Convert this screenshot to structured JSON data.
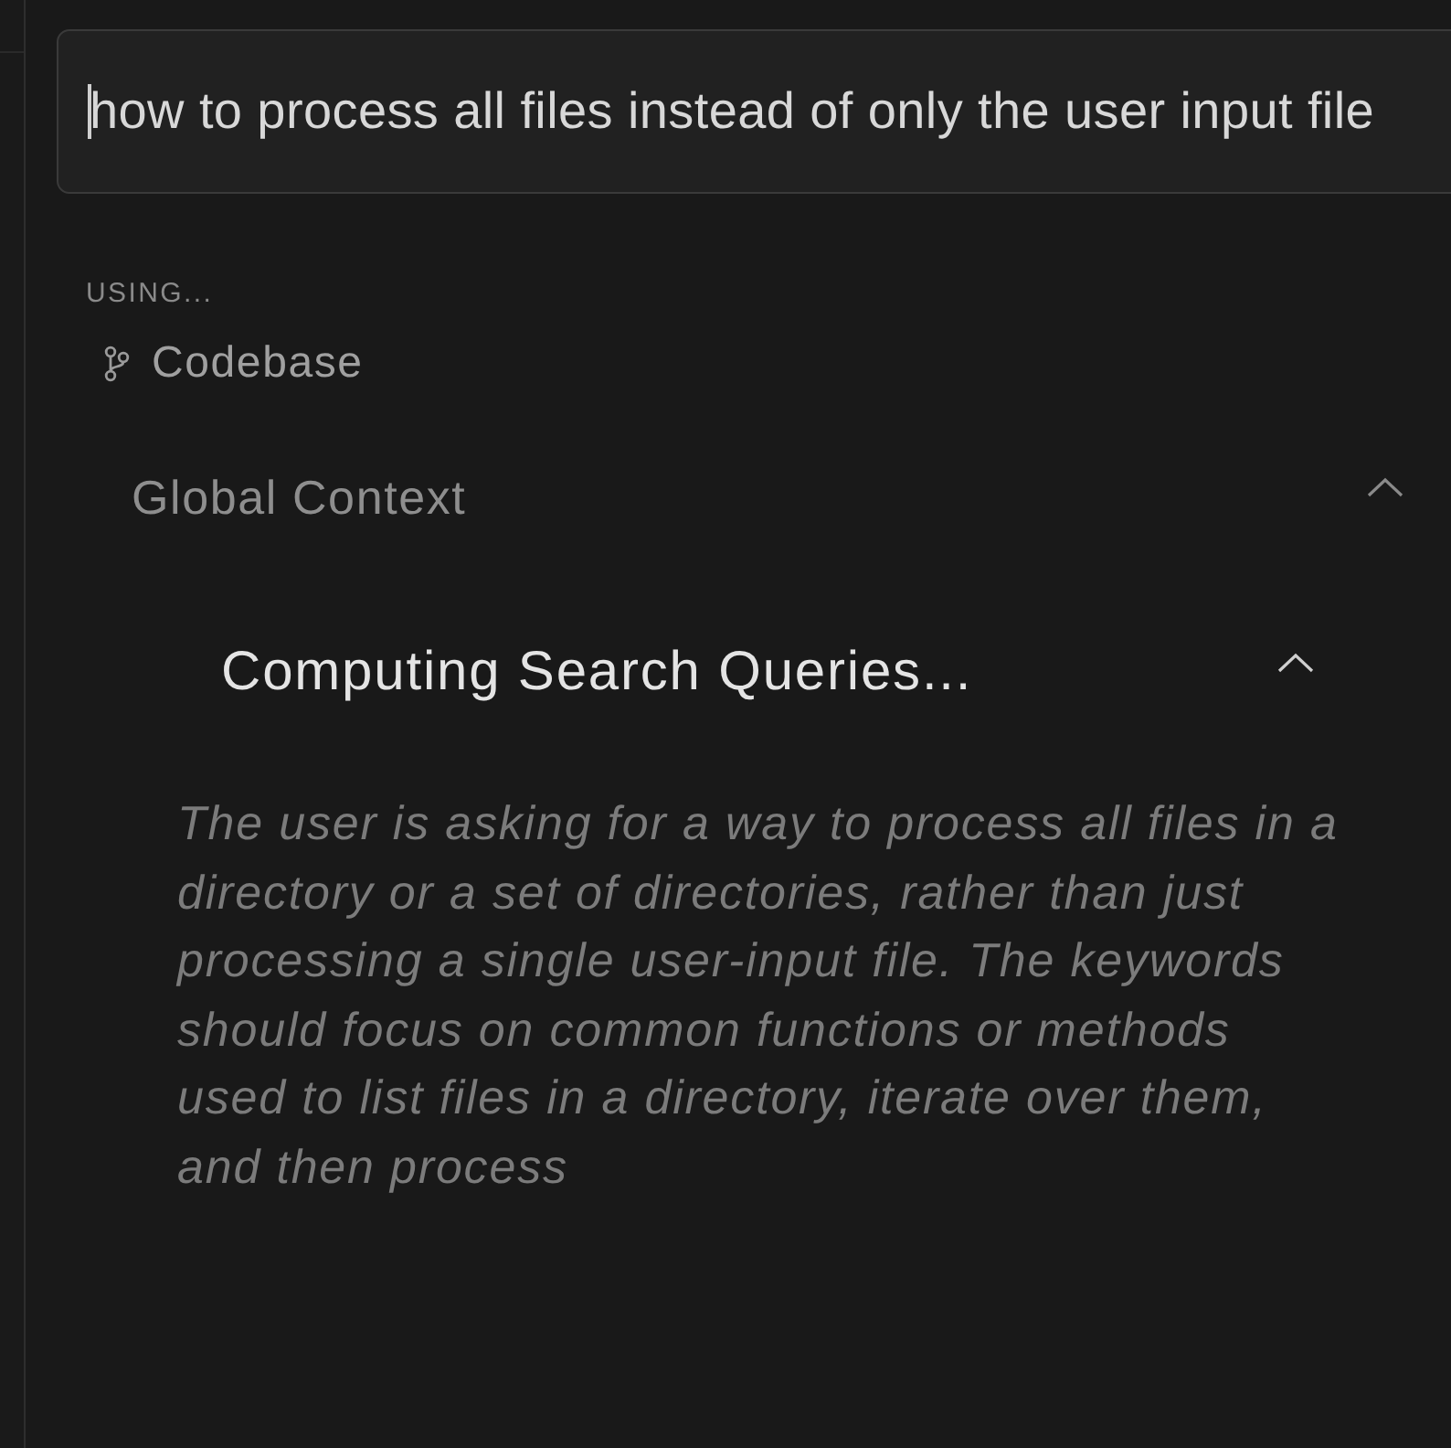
{
  "query_field": {
    "value": "how to process all files instead of only the user input file",
    "focused": true
  },
  "context": {
    "heading": "USING...",
    "source": {
      "label": "Codebase"
    }
  },
  "sections": [
    {
      "title": "Global Context",
      "expanded": true,
      "children": [
        {
          "title": "Computing Search Queries...",
          "expanded": true,
          "text": "The user is asking for a way to process all files in a directory or a set of directories, rather than just processing a single user-input file. The keywords should focus on common functions or methods used to list files in a directory, iterate over them, and then process"
        }
      ]
    }
  ]
}
